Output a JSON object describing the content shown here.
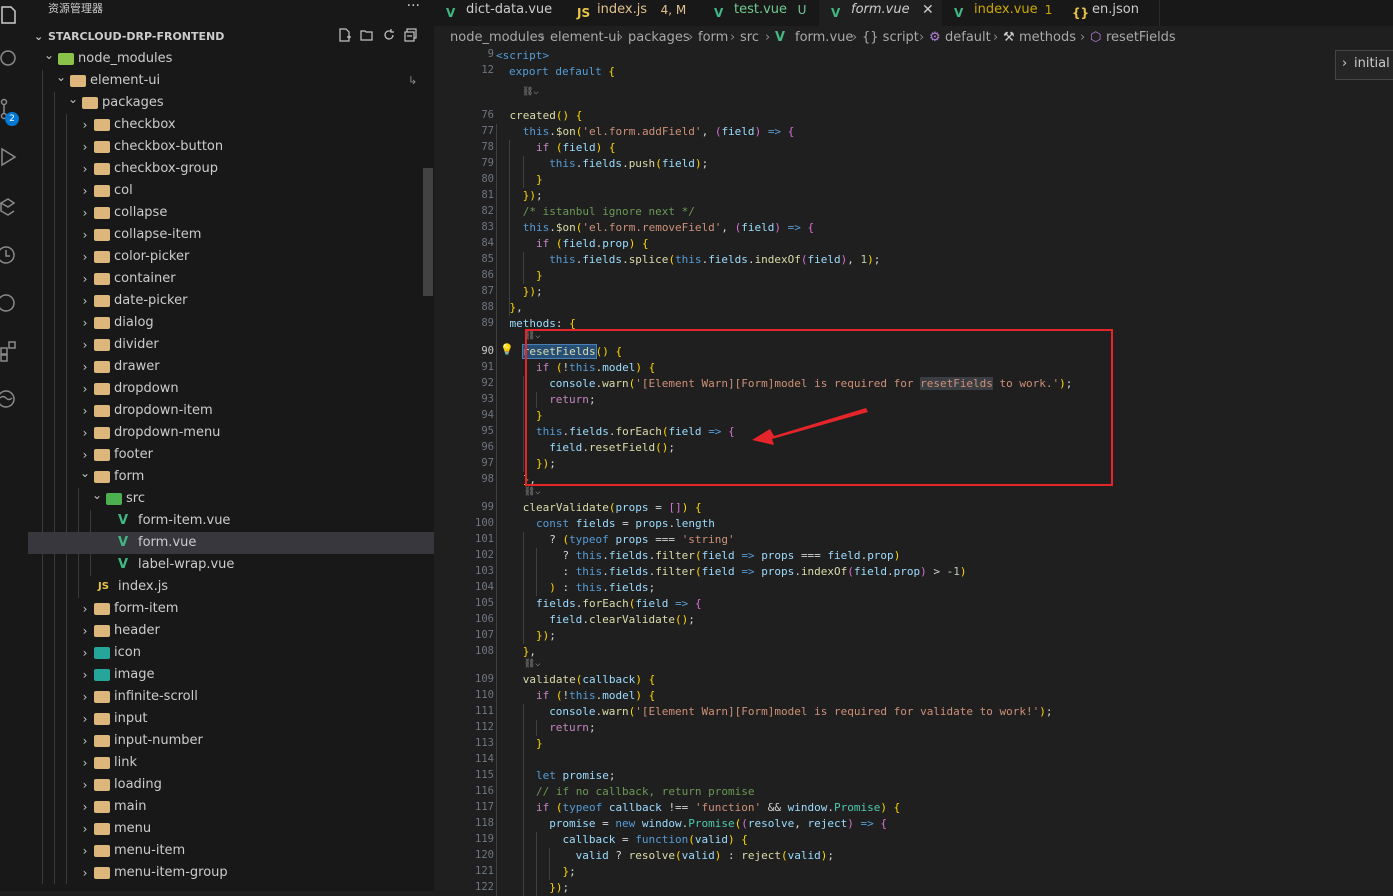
{
  "sidebar": {
    "title": "资源管理器",
    "more": "···",
    "root": "STARCLOUD-DRP-FRONTEND",
    "tree": [
      {
        "name": "node_modules",
        "kind": "folder-special",
        "depth": 1,
        "open": true
      },
      {
        "name": "element-ui",
        "kind": "folder",
        "depth": 2,
        "open": true
      },
      {
        "name": "packages",
        "kind": "folder",
        "depth": 3,
        "open": true
      },
      {
        "name": "checkbox",
        "kind": "folder",
        "depth": 4
      },
      {
        "name": "checkbox-button",
        "kind": "folder",
        "depth": 4
      },
      {
        "name": "checkbox-group",
        "kind": "folder",
        "depth": 4
      },
      {
        "name": "col",
        "kind": "folder",
        "depth": 4
      },
      {
        "name": "collapse",
        "kind": "folder",
        "depth": 4
      },
      {
        "name": "collapse-item",
        "kind": "folder",
        "depth": 4
      },
      {
        "name": "color-picker",
        "kind": "folder",
        "depth": 4
      },
      {
        "name": "container",
        "kind": "folder",
        "depth": 4
      },
      {
        "name": "date-picker",
        "kind": "folder",
        "depth": 4
      },
      {
        "name": "dialog",
        "kind": "folder",
        "depth": 4
      },
      {
        "name": "divider",
        "kind": "folder",
        "depth": 4
      },
      {
        "name": "drawer",
        "kind": "folder",
        "depth": 4
      },
      {
        "name": "dropdown",
        "kind": "folder",
        "depth": 4
      },
      {
        "name": "dropdown-item",
        "kind": "folder",
        "depth": 4
      },
      {
        "name": "dropdown-menu",
        "kind": "folder",
        "depth": 4
      },
      {
        "name": "footer",
        "kind": "folder",
        "depth": 4
      },
      {
        "name": "form",
        "kind": "folder",
        "depth": 4,
        "open": true
      },
      {
        "name": "src",
        "kind": "folder-src",
        "depth": 5,
        "open": true
      },
      {
        "name": "form-item.vue",
        "kind": "vue",
        "depth": 6
      },
      {
        "name": "form.vue",
        "kind": "vue",
        "depth": 6,
        "selected": true
      },
      {
        "name": "label-wrap.vue",
        "kind": "vue",
        "depth": 6
      },
      {
        "name": "index.js",
        "kind": "js",
        "depth": 5
      },
      {
        "name": "form-item",
        "kind": "folder",
        "depth": 4
      },
      {
        "name": "header",
        "kind": "folder",
        "depth": 4
      },
      {
        "name": "icon",
        "kind": "folder-icon",
        "depth": 4
      },
      {
        "name": "image",
        "kind": "folder-image",
        "depth": 4
      },
      {
        "name": "infinite-scroll",
        "kind": "folder",
        "depth": 4
      },
      {
        "name": "input",
        "kind": "folder",
        "depth": 4
      },
      {
        "name": "input-number",
        "kind": "folder",
        "depth": 4
      },
      {
        "name": "link",
        "kind": "folder",
        "depth": 4
      },
      {
        "name": "loading",
        "kind": "folder",
        "depth": 4
      },
      {
        "name": "main",
        "kind": "folder",
        "depth": 4
      },
      {
        "name": "menu",
        "kind": "folder",
        "depth": 4
      },
      {
        "name": "menu-item",
        "kind": "folder",
        "depth": 4
      },
      {
        "name": "menu-item-group",
        "kind": "folder",
        "depth": 4
      }
    ],
    "badge": "2"
  },
  "tabs": [
    {
      "icon": "V",
      "label": "dict-data.vue",
      "status": "",
      "color": "#cccccc"
    },
    {
      "icon": "JS",
      "label": "index.js",
      "status": "4, M",
      "color": "#e2c08d"
    },
    {
      "icon": "V",
      "label": "test.vue",
      "status": "U",
      "color": "#73c991"
    },
    {
      "icon": "V",
      "label": "form.vue",
      "status": "",
      "color": "#cccccc",
      "active": true,
      "italic": true,
      "close": "✕"
    },
    {
      "icon": "V",
      "label": "index.vue",
      "status": "1",
      "color": "#cca700"
    },
    {
      "icon": "{}",
      "label": "en.json",
      "status": "",
      "color": "#cccccc"
    }
  ],
  "breadcrumbs": [
    "node_modules",
    "element-ui",
    "packages",
    "form",
    "src",
    "form.vue",
    "{} script",
    "default",
    "methods",
    "resetFields"
  ],
  "peek_button": "initial",
  "code": {
    "sticky": [
      {
        "ln": "9",
        "text": "<script>"
      },
      {
        "ln": "12",
        "text": "export default {"
      }
    ],
    "lines": [
      {
        "ln": "76",
        "text": "created() {"
      },
      {
        "ln": "77",
        "text": "this.$on('el.form.addField', (field) => {"
      },
      {
        "ln": "78",
        "text": "if (field) {"
      },
      {
        "ln": "79",
        "text": "this.fields.push(field);"
      },
      {
        "ln": "80",
        "text": "}"
      },
      {
        "ln": "81",
        "text": "});"
      },
      {
        "ln": "82",
        "text": "/* istanbul ignore next */"
      },
      {
        "ln": "83",
        "text": "this.$on('el.form.removeField', (field) => {"
      },
      {
        "ln": "84",
        "text": "if (field.prop) {"
      },
      {
        "ln": "85",
        "text": "this.fields.splice(this.fields.indexOf(field), 1);"
      },
      {
        "ln": "86",
        "text": "}"
      },
      {
        "ln": "87",
        "text": "});"
      },
      {
        "ln": "88",
        "text": "},"
      },
      {
        "ln": "89",
        "text": "methods: {"
      },
      {
        "ln": "90",
        "text": "resetFields() {"
      },
      {
        "ln": "91",
        "text": "if (!this.model) {"
      },
      {
        "ln": "92",
        "text": "console.warn('[Element Warn][Form]model is required for resetFields to work.');"
      },
      {
        "ln": "93",
        "text": "return;"
      },
      {
        "ln": "94",
        "text": "}"
      },
      {
        "ln": "95",
        "text": "this.fields.forEach(field => {"
      },
      {
        "ln": "96",
        "text": "field.resetField();"
      },
      {
        "ln": "97",
        "text": "});"
      },
      {
        "ln": "98",
        "text": "},"
      },
      {
        "ln": "99",
        "text": "clearValidate(props = []) {"
      },
      {
        "ln": "100",
        "text": "const fields = props.length"
      },
      {
        "ln": "101",
        "text": "? (typeof props === 'string'"
      },
      {
        "ln": "102",
        "text": "? this.fields.filter(field => props === field.prop)"
      },
      {
        "ln": "103",
        "text": ": this.fields.filter(field => props.indexOf(field.prop) > -1)"
      },
      {
        "ln": "104",
        "text": ") : this.fields;"
      },
      {
        "ln": "105",
        "text": "fields.forEach(field => {"
      },
      {
        "ln": "106",
        "text": "field.clearValidate();"
      },
      {
        "ln": "107",
        "text": "});"
      },
      {
        "ln": "108",
        "text": "},"
      },
      {
        "ln": "109",
        "text": "validate(callback) {"
      },
      {
        "ln": "110",
        "text": "if (!this.model) {"
      },
      {
        "ln": "111",
        "text": "console.warn('[Element Warn][Form]model is required for validate to work!');"
      },
      {
        "ln": "112",
        "text": "return;"
      },
      {
        "ln": "113",
        "text": "}"
      },
      {
        "ln": "114",
        "text": ""
      },
      {
        "ln": "115",
        "text": "let promise;"
      },
      {
        "ln": "116",
        "text": "// if no callback, return promise"
      },
      {
        "ln": "117",
        "text": "if (typeof callback !== 'function' && window.Promise) {"
      },
      {
        "ln": "118",
        "text": "promise = new window.Promise((resolve, reject) => {"
      },
      {
        "ln": "119",
        "text": "callback = function(valid) {"
      },
      {
        "ln": "120",
        "text": "valid ? resolve(valid) : reject(valid);"
      },
      {
        "ln": "121",
        "text": "};"
      },
      {
        "ln": "122",
        "text": "});"
      }
    ],
    "codelens": "⛓⌵"
  },
  "annotation": {
    "box_color": "#e5252a",
    "arrow_color": "#e5252a"
  }
}
